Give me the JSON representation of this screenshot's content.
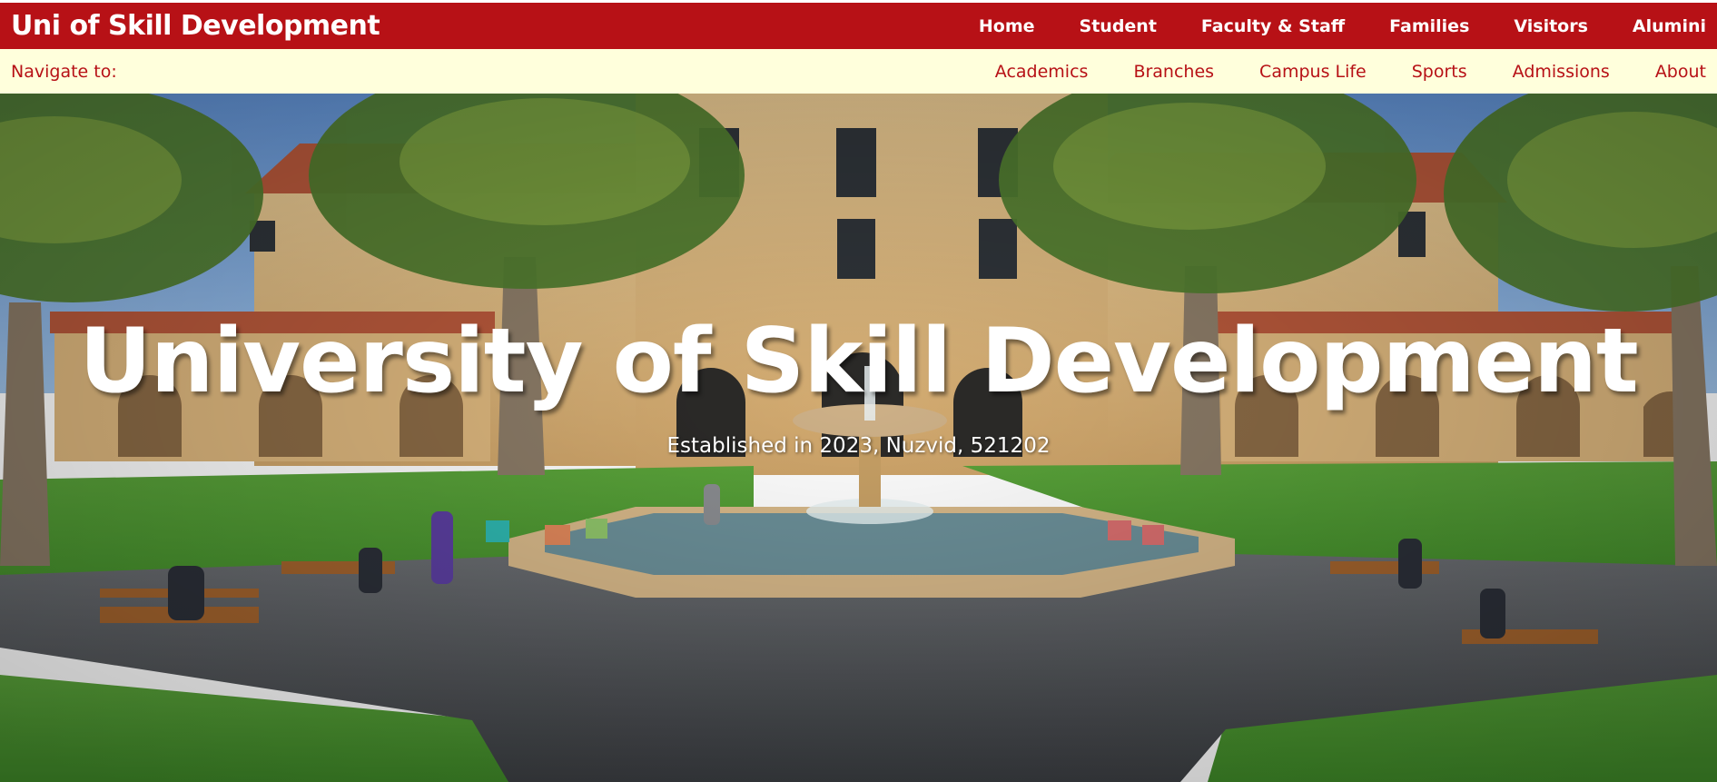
{
  "header": {
    "brand": "Uni of Skill Development",
    "nav": [
      "Home",
      "Student",
      "Faculty & Staff",
      "Families",
      "Visitors",
      "Alumini"
    ]
  },
  "subnav": {
    "label": "Navigate to:",
    "items": [
      "Academics",
      "Branches",
      "Campus Life",
      "Sports",
      "Admissions",
      "About"
    ]
  },
  "hero": {
    "title": "University of Skill Development",
    "subtitle": "Established in 2023, Nuzvid, 521202",
    "image": "campus-courtyard-photo"
  },
  "colors": {
    "brand_red": "#b71116",
    "subnav_bg": "#ffffdc",
    "text_white": "#ffffff"
  }
}
